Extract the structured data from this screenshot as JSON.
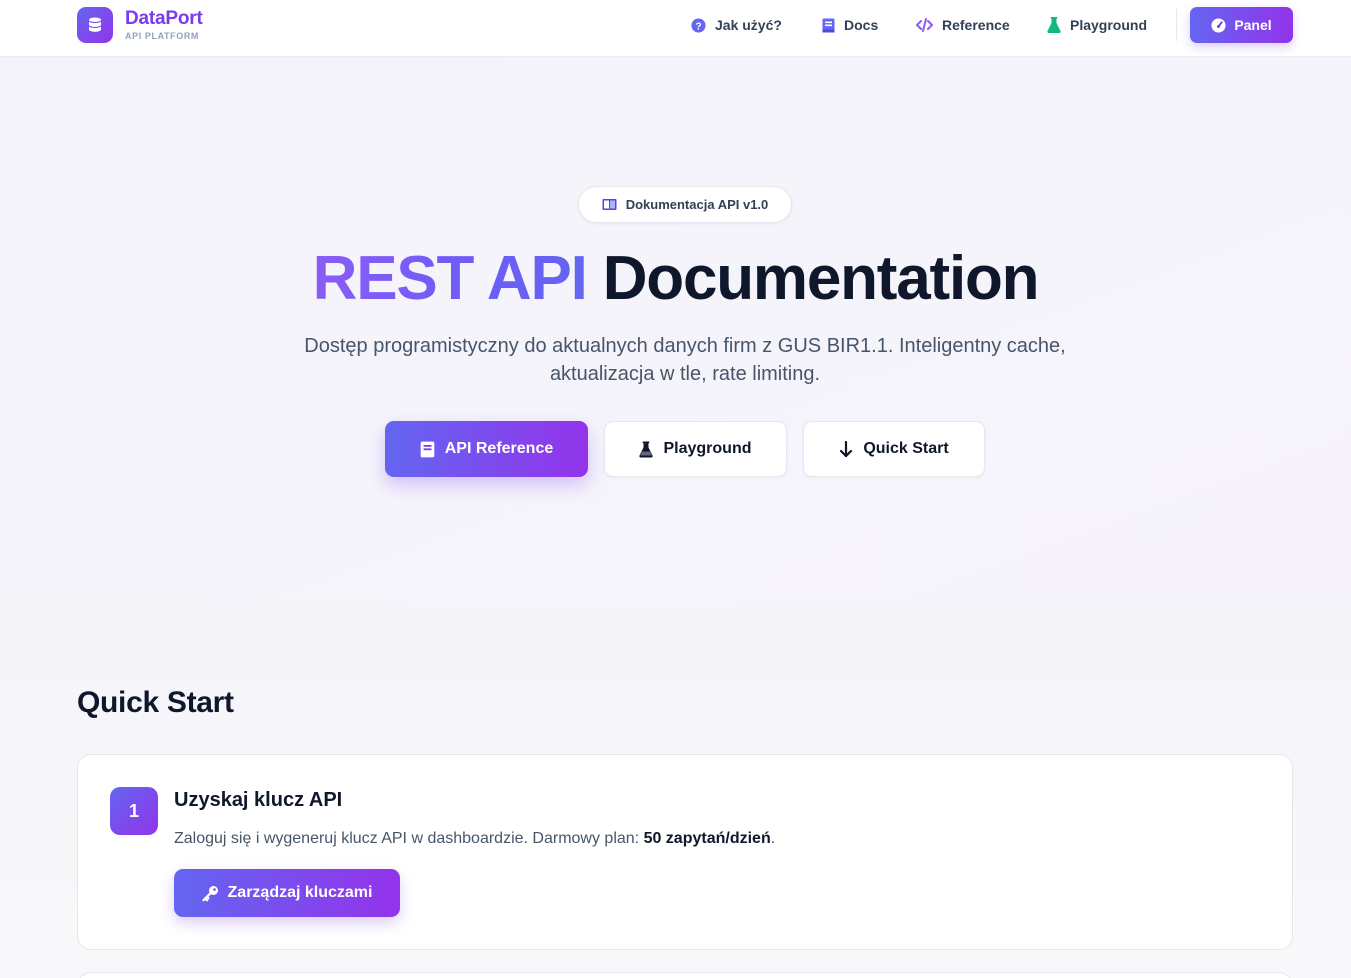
{
  "brand": {
    "title": "DataPort",
    "subtitle": "API PLATFORM"
  },
  "nav": {
    "items": [
      {
        "label": "Jak użyć?",
        "icon": "question-circle-icon"
      },
      {
        "label": "Docs",
        "icon": "book-icon"
      },
      {
        "label": "Reference",
        "icon": "code-icon"
      },
      {
        "label": "Playground",
        "icon": "flask-icon"
      }
    ],
    "panel": {
      "label": "Panel",
      "icon": "gauge-icon"
    }
  },
  "hero": {
    "badge": "Dokumentacja API v1.0",
    "title_accent": "REST API",
    "title_main": "Documentation",
    "subtitle": "Dostęp programistyczny do aktualnych danych firm z GUS BIR1.1. Inteligentny cache, aktualizacja w tle, rate limiting.",
    "buttons": {
      "primary": "API Reference",
      "playground": "Playground",
      "quickstart": "Quick Start"
    }
  },
  "quickstart": {
    "title": "Quick Start",
    "steps": [
      {
        "number": "1",
        "title": "Uzyskaj klucz API",
        "desc_prefix": "Zaloguj się i wygeneruj klucz API w dashboardzie. Darmowy plan: ",
        "desc_bold": "50 zapytań/dzień",
        "desc_suffix": ".",
        "button": "Zarządzaj kluczami"
      }
    ]
  },
  "colors": {
    "accent_start": "#6366f1",
    "accent_end": "#9333ea",
    "flask_green": "#10b981",
    "text_dark": "#0f172a",
    "text_muted": "#475569"
  }
}
